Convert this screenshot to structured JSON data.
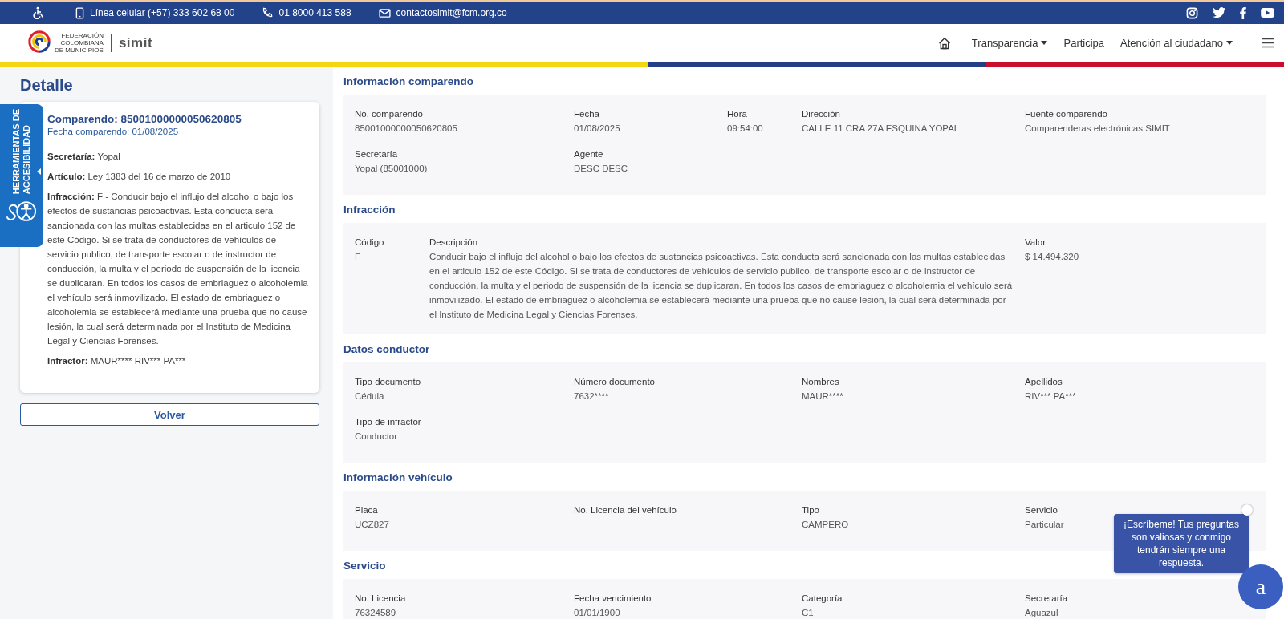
{
  "top_bar": {
    "contacts": [
      {
        "kind": "accessibility"
      },
      {
        "kind": "mobile",
        "text": "Línea celular (+57) 333 602 68 00"
      },
      {
        "kind": "phone",
        "text": "01 8000 413 588"
      },
      {
        "kind": "mail",
        "text": "contactosimit@fcm.org.co"
      }
    ],
    "social": [
      {
        "kind": "instagram"
      },
      {
        "kind": "twitter"
      },
      {
        "kind": "facebook"
      },
      {
        "kind": "youtube"
      }
    ]
  },
  "logo": {
    "org_lines": [
      "FEDERACIÓN",
      "COLOMBIANA",
      "DE MUNICIPIOS"
    ],
    "brand": "simit"
  },
  "nav": [
    {
      "kind": "home"
    },
    {
      "kind": "link",
      "label": "Transparencia",
      "dropdown": true
    },
    {
      "kind": "link",
      "label": "Participa",
      "dropdown": false
    },
    {
      "kind": "link",
      "label": "Atención al ciudadano",
      "dropdown": true
    },
    {
      "kind": "menu"
    }
  ],
  "detail": {
    "title": "Detalle",
    "card": {
      "heading": "Comparendo: 85001000000050620805",
      "date": "Fecha comparendo: 01/08/2025",
      "fields": [
        {
          "label": "Secretaría:",
          "value": "Yopal"
        },
        {
          "label": "Artículo:",
          "value": "Ley 1383 del 16 de marzo de 2010"
        },
        {
          "label": "Infracción:",
          "value": "F - Conducir bajo el influjo del alcohol o bajo los efectos de sustancias psicoactivas. Esta conducta será sancionada con las multas establecidas en el articulo 152 de este Código. Si se trata de conductores de vehículos de servicio publico, de transporte escolar o de instructor de conducción, la multa y el periodo de suspensión de la licencia se duplicaran. En todos los casos de embriaguez o alcoholemia el vehículo será inmovilizado. El estado de embriaguez o alcoholemia se establecerá mediante una prueba que no cause lesión, la cual será determinada por el Instituto de Medicina Legal y Ciencias Forenses."
        },
        {
          "label": "Infractor:",
          "value": "MAUR**** RIV*** PA***"
        }
      ]
    },
    "back_button": "Volver"
  },
  "sections": [
    {
      "title": "Información comparendo",
      "kind": "five",
      "rows": [
        [
          {
            "label": "No. comparendo",
            "value": "85001000000050620805"
          },
          {
            "label": "Fecha",
            "value": "01/08/2025"
          },
          {
            "label": "Hora",
            "value": "09:54:00"
          },
          {
            "label": "Dirección",
            "value": "CALLE 11 CRA 27A ESQUINA YOPAL"
          },
          {
            "label": "Fuente comparendo",
            "value": "Comparenderas electrónicas SIMIT"
          }
        ],
        [
          {
            "label": "Secretaría",
            "value": "Yopal (85001000)"
          },
          {
            "label": "Agente",
            "value": "DESC DESC"
          }
        ]
      ]
    },
    {
      "title": "Infracción",
      "kind": "three",
      "rows": [
        [
          {
            "label": "Código",
            "value": "F"
          },
          {
            "label": "Descripción",
            "value": "Conducir bajo el influjo del alcohol o bajo los efectos de sustancias psicoactivas. Esta conducta será sancionada con las multas establecidas en el articulo 152 de este Código. Si se trata de conductores de vehículos de servicio publico, de transporte escolar o de instructor de conducción, la multa y el periodo de suspensión de la licencia se duplicaran. En todos los casos de embriaguez o alcoholemia el vehículo será inmovilizado. El estado de embriaguez o alcoholemia se establecerá mediante una prueba que no cause lesión, la cual será determinada por el Instituto de Medicina Legal y Ciencias Forenses."
          },
          {
            "label": "Valor",
            "value": "$ 14.494.320"
          }
        ]
      ]
    },
    {
      "title": "Datos conductor",
      "kind": "four",
      "rows": [
        [
          {
            "label": "Tipo documento",
            "value": "Cédula"
          },
          {
            "label": "Número documento",
            "value": "7632****"
          },
          {
            "label": "Nombres",
            "value": "MAUR****"
          },
          {
            "label": "Apellidos",
            "value": "RIV*** PA***"
          }
        ],
        [
          {
            "label": "Tipo de infractor",
            "value": "Conductor"
          }
        ]
      ]
    },
    {
      "title": "Información vehículo",
      "kind": "four",
      "rows": [
        [
          {
            "label": "Placa",
            "value": "UCZ827"
          },
          {
            "label": "No. Licencia del vehículo"
          },
          {
            "label": "Tipo",
            "value": "CAMPERO"
          },
          {
            "label": "Servicio",
            "value": "Particular"
          }
        ]
      ]
    },
    {
      "title": "Servicio",
      "kind": "four",
      "rows": [
        [
          {
            "label": "No. Licencia",
            "value": "76324589"
          },
          {
            "label": "Fecha vencimiento",
            "value": "01/01/1900"
          },
          {
            "label": "Categoría",
            "value": "C1"
          },
          {
            "label": "Secretaría",
            "value": "Aguazul"
          }
        ]
      ]
    }
  ],
  "accessibility_tab": {
    "lines": [
      "HERRAMIENTAS DE",
      "ACCESIBILIDAD"
    ]
  },
  "chat": {
    "message": "¡Escríbeme! Tus preguntas son valiosas y conmigo tendrán siempre una respuesta.",
    "avatar": "a"
  }
}
